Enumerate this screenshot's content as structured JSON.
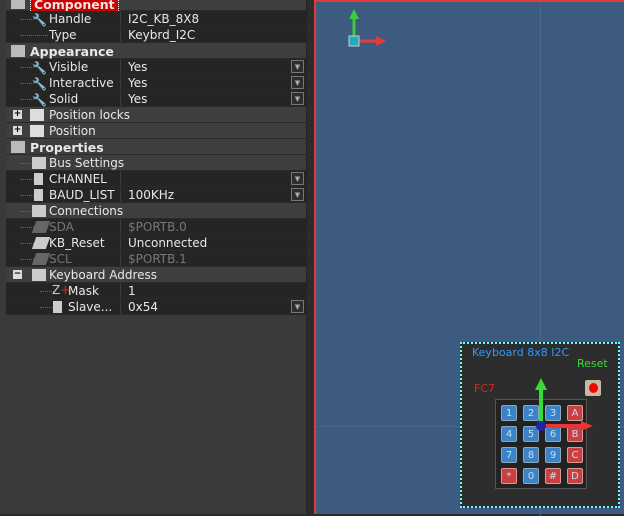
{
  "properties": {
    "component": {
      "label": "Component"
    },
    "handle": {
      "label": "Handle",
      "value": "I2C_KB_8X8"
    },
    "type": {
      "label": "Type",
      "value": "Keybrd_I2C"
    },
    "appearance": {
      "label": "Appearance"
    },
    "visible": {
      "label": "Visible",
      "value": "Yes"
    },
    "interactive": {
      "label": "Interactive",
      "value": "Yes"
    },
    "solid": {
      "label": "Solid",
      "value": "Yes"
    },
    "position_locks": {
      "label": "Position locks"
    },
    "position": {
      "label": "Position"
    },
    "props": {
      "label": "Properties"
    },
    "bus_settings": {
      "label": "Bus Settings"
    },
    "channel": {
      "label": "CHANNEL",
      "value": ""
    },
    "baud_list": {
      "label": "BAUD_LIST",
      "value": "100KHz"
    },
    "connections": {
      "label": "Connections"
    },
    "sda": {
      "label": "SDA",
      "value": "$PORTB.0"
    },
    "kb_reset": {
      "label": "KB_Reset",
      "value": "Unconnected"
    },
    "scl": {
      "label": "SCL",
      "value": "$PORTB.1"
    },
    "keyboard_address": {
      "label": "Keyboard Address"
    },
    "mask": {
      "label": "Mask",
      "value": "1"
    },
    "slave": {
      "label": "Slave...",
      "value": "0x54"
    }
  },
  "canvas": {
    "keyboard": {
      "title": "Keyboard 8x8 I2C",
      "reset_label": "Reset",
      "pin_label": "FC7",
      "keys": [
        "1",
        "2",
        "3",
        "A",
        "4",
        "5",
        "6",
        "B",
        "7",
        "8",
        "9",
        "C",
        "*",
        "0",
        "#",
        "D"
      ]
    }
  },
  "colors": {
    "selection_border": "#e03c3c",
    "canvas_bg": "#3d5a80",
    "x_axis": "#e03c3c",
    "y_axis": "#3ccc3c"
  }
}
